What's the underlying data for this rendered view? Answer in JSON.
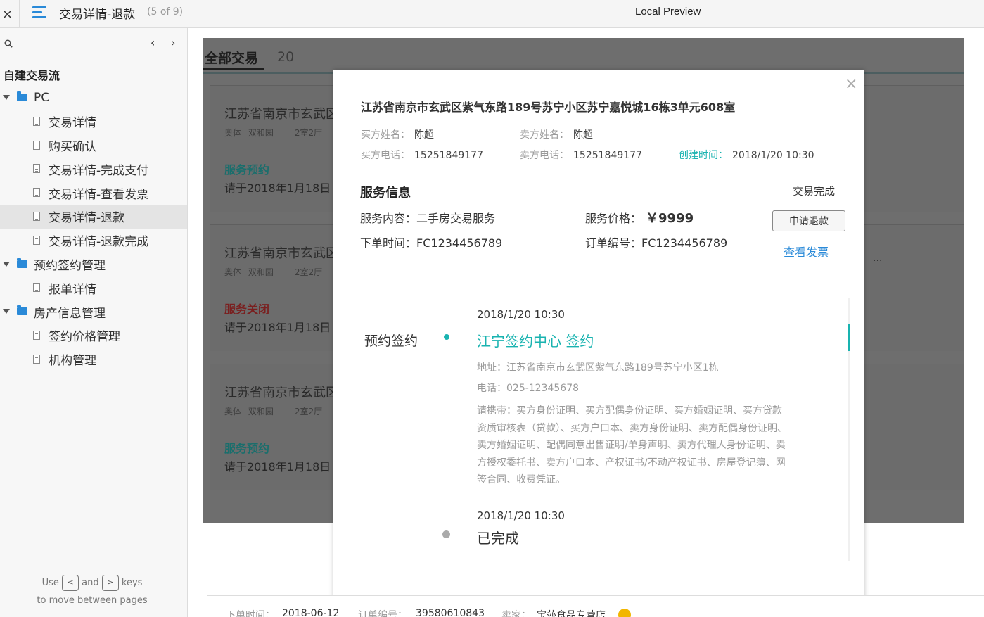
{
  "topbar": {
    "close": "×",
    "page_name": "交易详情-退款",
    "page_count": "(5 of 9)",
    "preview_title": "Local Preview"
  },
  "sidebar": {
    "prev": "‹",
    "next": "›",
    "root": "自建交易流",
    "tree": [
      {
        "type": "folder",
        "label": "PC"
      },
      {
        "type": "page",
        "label": "交易详情"
      },
      {
        "type": "page",
        "label": "购买确认"
      },
      {
        "type": "page",
        "label": "交易详情-完成支付"
      },
      {
        "type": "page",
        "label": "交易详情-查看发票"
      },
      {
        "type": "page",
        "label": "交易详情-退款",
        "selected": true
      },
      {
        "type": "page",
        "label": "交易详情-退款完成"
      },
      {
        "type": "folder",
        "label": "预约签约管理"
      },
      {
        "type": "page",
        "label": "报单详情"
      },
      {
        "type": "folder",
        "label": "房产信息管理"
      },
      {
        "type": "page",
        "label": "签约价格管理"
      },
      {
        "type": "page",
        "label": "机构管理"
      }
    ],
    "hint": {
      "use": "Use",
      "and": "and",
      "keys": "keys",
      "key_left": "<",
      "key_right": ">",
      "line2": "to move between pages"
    }
  },
  "background": {
    "tab_label": "全部交易",
    "tab_count": "20",
    "cards": [
      {
        "addr": "江苏省南京市玄武区",
        "area": "奥体",
        "sub": "双和园",
        "rooms": "2室2厅",
        "status": "服务预约",
        "status_color": "#1a6e6c",
        "date": "请于2018年1月18日"
      },
      {
        "addr": "江苏省南京市玄武区",
        "area": "奥体",
        "sub": "双和园",
        "rooms": "2室2厅",
        "status": "服务关闭",
        "status_color": "#7a1f1f",
        "date": "请于2018年1月18日"
      },
      {
        "addr": "江苏省南京市玄武区",
        "area": "奥体",
        "sub": "双和园",
        "rooms": "2室2厅",
        "status": "服务预约",
        "status_color": "#1a6e6c",
        "date": "请于2018年1月18日"
      }
    ],
    "ellipsis": "..."
  },
  "modal": {
    "close": "×",
    "address": "江苏省南京市玄武区紫气东路189号苏宁小区苏宁嘉悦城16栋3单元608室",
    "buyer_name_label": "买方姓名：",
    "buyer_name": "陈超",
    "seller_name_label": "卖方姓名：",
    "seller_name": "陈超",
    "buyer_phone_label": "买方电话：",
    "buyer_phone": "15251849177",
    "seller_phone_label": "卖方电话：",
    "seller_phone": "15251849177",
    "created_label": "创建时间：",
    "created": "2018/1/20  10:30",
    "service": {
      "title": "服务信息",
      "status": "交易完成",
      "content_label": "服务内容：",
      "content": "二手房交易服务",
      "price_label": "服务价格：",
      "price": "￥9999",
      "order_time_label": "下单时间：",
      "order_time": "FC1234456789",
      "order_no_label": "订单编号：",
      "order_no": "FC1234456789",
      "refund_button": "申请退款",
      "invoice_link": "查看发票"
    },
    "timeline": {
      "stage": "预约签约",
      "event1_date": "2018/1/20  10:30",
      "event1_title": "江宁签约中心 签约",
      "event1_address": "地址：江苏省南京市玄武区紫气东路189号苏宁小区1栋",
      "event1_phone": "电话：025-12345678",
      "event1_bring": "请携带：买方身份证明、买方配偶身份证明、买方婚姻证明、买方贷款资质审核表（贷款）、买方户口本、卖方身份证明、卖方配偶身份证明、卖方婚姻证明、配偶同意出售证明/单身声明、卖方代理人身份证明、卖方授权委托书、卖方户口本、产权证书/不动产权证书、房屋登记簿、网签合同、收费凭证。",
      "event2_date": "2018/1/20  10:30",
      "event2_title": "已完成"
    }
  },
  "bottom": {
    "order_time_label": "下单时间：",
    "order_time": "2018-06-12",
    "order_no_label": "订单编号：",
    "order_no": "39580610843",
    "seller_label": "卖家：",
    "seller": "宝莎食品专营店"
  },
  "colors": {
    "accent": "#2a8ad8",
    "teal": "#19b3b0"
  }
}
